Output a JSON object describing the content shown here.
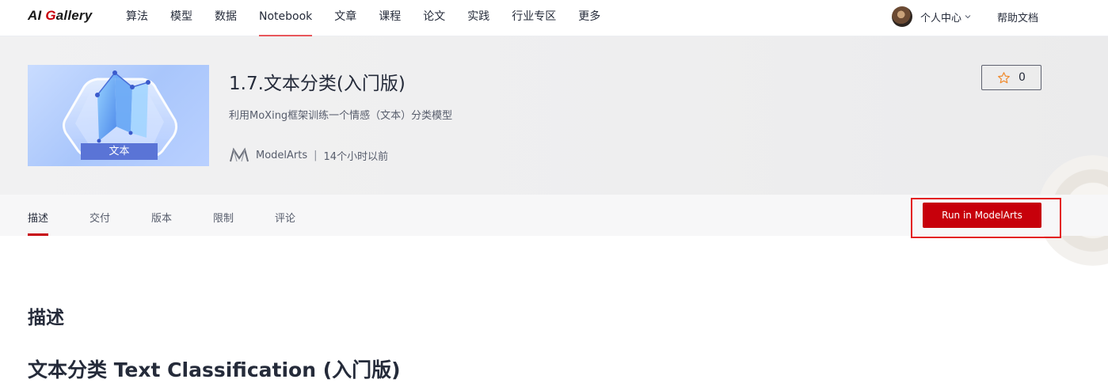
{
  "nav": {
    "logo_a": "AI ",
    "logo_g": "G",
    "logo_b": "allery",
    "items": [
      "算法",
      "模型",
      "数据",
      "Notebook",
      "文章",
      "课程",
      "论文",
      "实践",
      "行业专区",
      "更多"
    ],
    "active_index": 3,
    "user_center": "个人中心",
    "help_docs": "帮助文档"
  },
  "asset": {
    "title": "1.7.文本分类(入门版)",
    "description": "利用MoXing框架训练一个情感（文本）分类模型",
    "thumb_label": "文本",
    "publisher": "ModelArts",
    "separator": "|",
    "time": "14个小时以前",
    "star_count": "0"
  },
  "tabs": [
    "描述",
    "交付",
    "版本",
    "限制",
    "评论"
  ],
  "active_tab": 0,
  "run_button": "Run in ModelArts",
  "content": {
    "section_title": "描述",
    "subtitle": "文本分类 Text Classification (入门版)"
  },
  "colors": {
    "brand": "#c7000b",
    "nav_active": "#e8565b",
    "highlight_box": "#e31f1f",
    "star": "#f08a2c"
  }
}
